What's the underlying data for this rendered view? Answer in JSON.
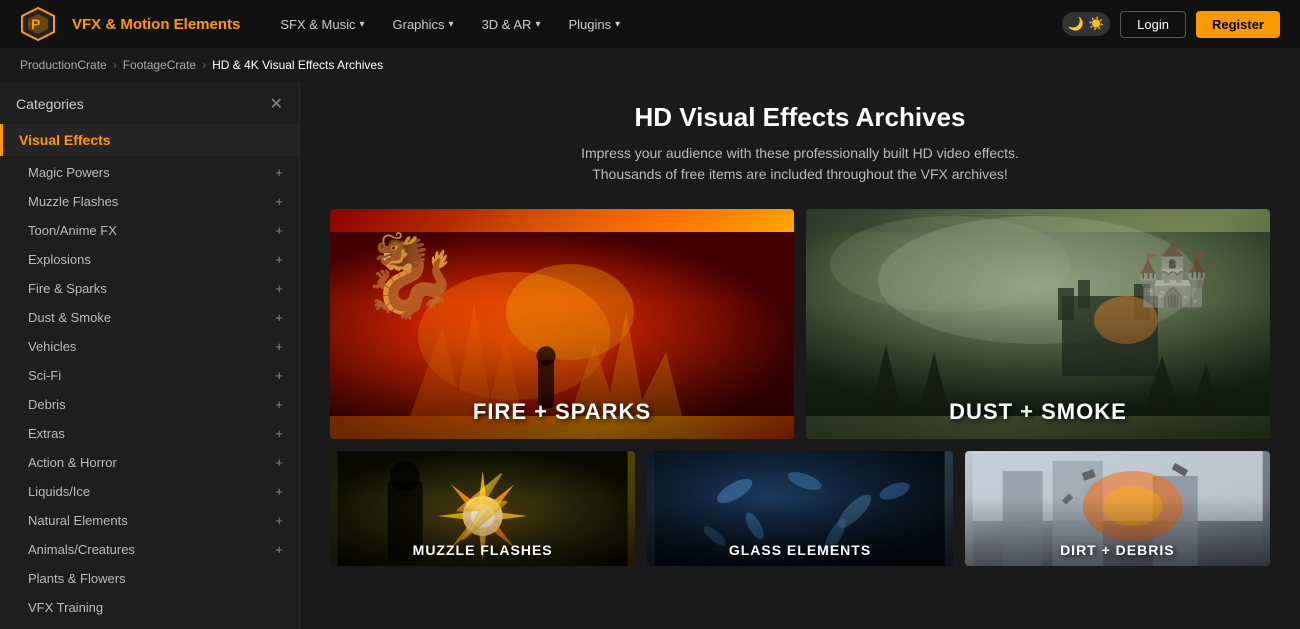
{
  "navbar": {
    "brand": "VFX & Motion Elements",
    "links": [
      {
        "label": "SFX & Music",
        "has_dropdown": true
      },
      {
        "label": "Graphics",
        "has_dropdown": true
      },
      {
        "label": "3D & AR",
        "has_dropdown": true
      },
      {
        "label": "Plugins",
        "has_dropdown": true
      }
    ],
    "login_label": "Login",
    "register_label": "Register"
  },
  "breadcrumb": {
    "items": [
      {
        "label": "ProductionCrate",
        "href": "#"
      },
      {
        "label": "FootageCrate",
        "href": "#"
      },
      {
        "label": "HD & 4K Visual Effects Archives",
        "current": true
      }
    ]
  },
  "sidebar": {
    "header": "Categories",
    "section": "Visual Effects",
    "items": [
      {
        "label": "Magic Powers",
        "expandable": true
      },
      {
        "label": "Muzzle Flashes",
        "expandable": true
      },
      {
        "label": "Toon/Anime FX",
        "expandable": true
      },
      {
        "label": "Explosions",
        "expandable": true
      },
      {
        "label": "Fire & Sparks",
        "expandable": true
      },
      {
        "label": "Dust & Smoke",
        "expandable": true
      },
      {
        "label": "Vehicles",
        "expandable": true
      },
      {
        "label": "Sci-Fi",
        "expandable": true
      },
      {
        "label": "Debris",
        "expandable": true
      },
      {
        "label": "Extras",
        "expandable": true
      },
      {
        "label": "Action & Horror",
        "expandable": true
      },
      {
        "label": "Liquids/Ice",
        "expandable": true
      },
      {
        "label": "Natural Elements",
        "expandable": true
      },
      {
        "label": "Animals/Creatures",
        "expandable": true
      },
      {
        "label": "Plants & Flowers",
        "expandable": false
      },
      {
        "label": "VFX Training",
        "expandable": false
      }
    ]
  },
  "page": {
    "title": "HD Visual Effects Archives",
    "subtitle": "Impress your audience with these professionally built HD video effects.\nThousands of free items are included throughout the VFX archives!",
    "cards_row1": [
      {
        "label": "FIRE + SPARKS",
        "type": "fire"
      },
      {
        "label": "DUST + SMOKE",
        "type": "dust"
      }
    ],
    "cards_row2": [
      {
        "label": "MUZZLE FLASHES",
        "type": "muzzle"
      },
      {
        "label": "GLASS ELEMENTS",
        "type": "glass"
      },
      {
        "label": "DIRT + DEBRIS",
        "type": "debris"
      }
    ]
  }
}
